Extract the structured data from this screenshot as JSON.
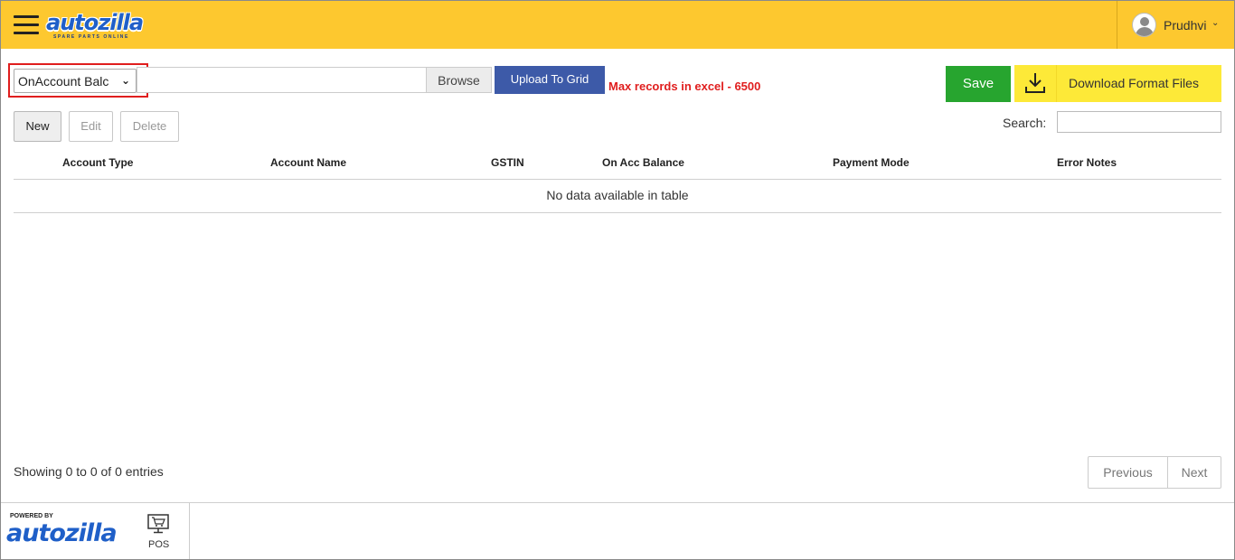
{
  "header": {
    "logo_text": "autozilla",
    "logo_tagline": "SPARE PARTS ONLINE",
    "user_name": "Prudhvi",
    "user_chevron": "⌄"
  },
  "toolbar": {
    "select_value": "OnAccount Balc",
    "browse_label": "Browse",
    "upload_label": "Upload To Grid",
    "max_note": "Max records in excel - 6500",
    "save_label": "Save",
    "download_label": "Download Format Files"
  },
  "actions": {
    "new_label": "New",
    "edit_label": "Edit",
    "delete_label": "Delete",
    "search_label": "Search:"
  },
  "table": {
    "columns": [
      "Account Type",
      "Account Name",
      "GSTIN",
      "On Acc Balance",
      "Payment Mode",
      "Error Notes"
    ],
    "empty_message": "No data available in table"
  },
  "pagination": {
    "info": "Showing 0 to 0 of 0 entries",
    "previous_label": "Previous",
    "next_label": "Next"
  },
  "footer": {
    "powered_by": "POWERED BY",
    "logo_text": "autozilla",
    "pos_label": "POS"
  },
  "colors": {
    "header_bg": "#fdc82f",
    "save_green": "#27a52f",
    "upload_blue": "#3d5aa8",
    "download_yellow": "#fde938",
    "warning_red": "#e01e1e"
  },
  "icons": {
    "menu": "hamburger-icon",
    "user": "avatar-icon",
    "download": "download-icon",
    "pos": "cart-monitor-icon"
  }
}
